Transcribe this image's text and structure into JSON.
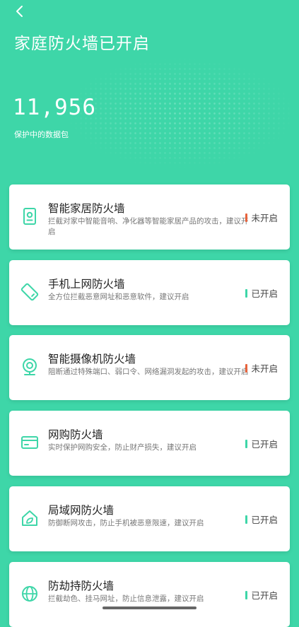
{
  "header": {
    "back_icon": "chevron-left-icon",
    "title": "家庭防火墙已开启"
  },
  "stats": {
    "packet_count": "11,956",
    "packet_label": "保护中的数据包"
  },
  "colors": {
    "background": "#3ed6a8",
    "accent": "#3ed6a8",
    "status_on": "#3ed6a8",
    "status_off": "#e8633c"
  },
  "cards": [
    {
      "icon": "smart-home-device-icon",
      "title": "智能家居防火墙",
      "desc": "拦截对家中智能音响、净化器等智能家居产品的攻击，建议开启",
      "status": "未开启",
      "enabled": false
    },
    {
      "icon": "mobile-phone-icon",
      "title": "手机上网防火墙",
      "desc": "全方位拦截恶意网址和恶意软件，建议开启",
      "status": "已开启",
      "enabled": true
    },
    {
      "icon": "camera-icon",
      "title": "智能摄像机防火墙",
      "desc": "阻断通过特殊端口、弱口令、网络漏洞发起的攻击，建议开启",
      "status": "未开启",
      "enabled": false
    },
    {
      "icon": "credit-card-icon",
      "title": "网购防火墙",
      "desc": "实时保护网购安全，防止财产损失，建议开启",
      "status": "已开启",
      "enabled": true
    },
    {
      "icon": "home-leaf-icon",
      "title": "局域网防火墙",
      "desc": "防御断网攻击，防止手机被恶意限速，建议开启",
      "status": "已开启",
      "enabled": true
    },
    {
      "icon": "globe-icon",
      "title": "防劫持防火墙",
      "desc": "拦截劫色、挂马网址，防止信息泄露，建议开启",
      "status": "已开启",
      "enabled": true
    }
  ]
}
